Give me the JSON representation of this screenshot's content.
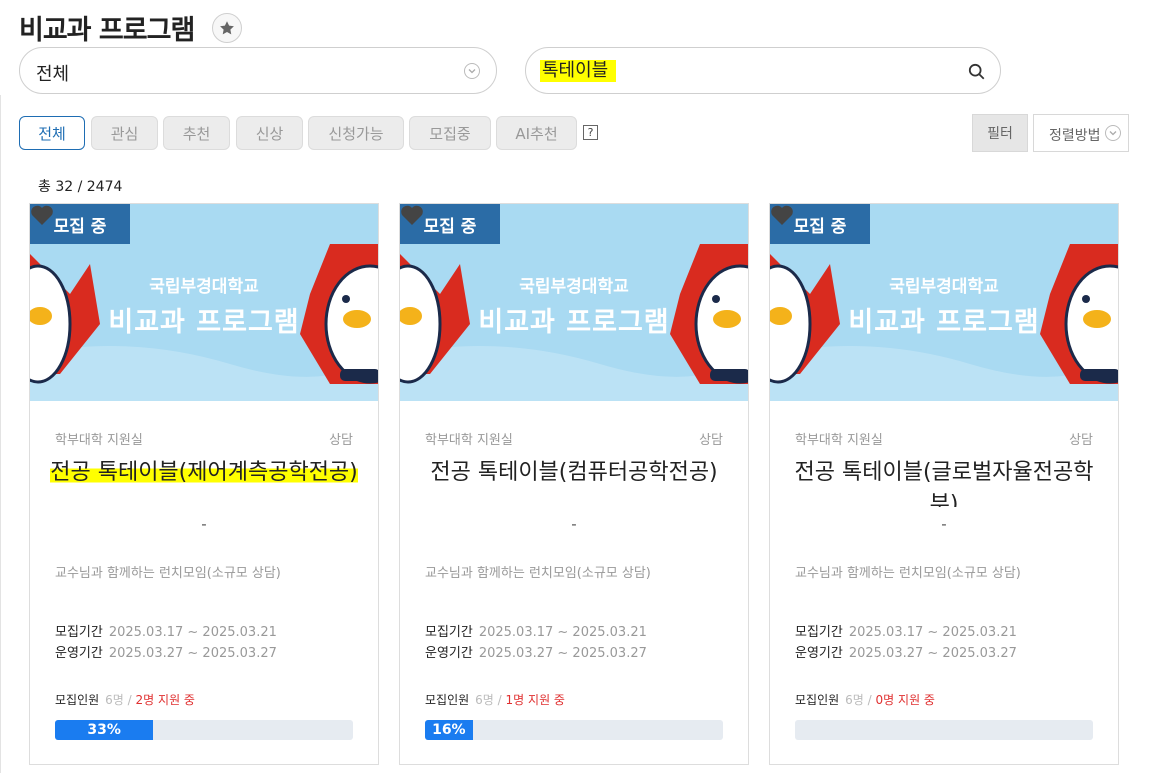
{
  "page": {
    "title": "비교과 프로그램"
  },
  "search": {
    "category_value": "전체",
    "query": "톡테이블"
  },
  "tabs": [
    "전체",
    "관심",
    "추천",
    "신상",
    "신청가능",
    "모집중",
    "AI추천"
  ],
  "help_label": "?",
  "toolbar": {
    "filter_label": "필터",
    "sort_label": "정렬방법"
  },
  "count_text": "총 32 / 2474",
  "colors": {
    "accent": "#1e6db3",
    "badge": "#2b6ca6",
    "progress": "#1a7cf0",
    "highlight": "#ffff00",
    "applied": "#e03030"
  },
  "cards": [
    {
      "badge": "모집 중",
      "banner_brand": "국립부경대학교",
      "banner_title": "비교과 프로그램",
      "dept": "학부대학 지원실",
      "category": "상담",
      "title": "전공 톡테이블(제어계측공학전공)",
      "dash": "-",
      "desc": "교수님과 함께하는 런치모임(소규모 상담)",
      "recruit_period_label": "모집기간",
      "recruit_period": "2025.03.17 ~ 2025.03.21",
      "run_period_label": "운영기간",
      "run_period": "2025.03.27 ~ 2025.03.27",
      "capacity_label": "모집인원",
      "capacity": "6명 /",
      "applied": "2명 지원 중",
      "progress_text": "33%",
      "progress": 0.33
    },
    {
      "badge": "모집 중",
      "banner_brand": "국립부경대학교",
      "banner_title": "비교과 프로그램",
      "dept": "학부대학 지원실",
      "category": "상담",
      "title": "전공 톡테이블(컴퓨터공학전공)",
      "dash": "-",
      "desc": "교수님과 함께하는 런치모임(소규모 상담)",
      "recruit_period_label": "모집기간",
      "recruit_period": "2025.03.17 ~ 2025.03.21",
      "run_period_label": "운영기간",
      "run_period": "2025.03.27 ~ 2025.03.27",
      "capacity_label": "모집인원",
      "capacity": "6명 /",
      "applied": "1명 지원 중",
      "progress_text": "16%",
      "progress": 0.16
    },
    {
      "badge": "모집 중",
      "banner_brand": "국립부경대학교",
      "banner_title": "비교과 프로그램",
      "dept": "학부대학 지원실",
      "category": "상담",
      "title": "전공 톡테이블(글로벌자율전공학부)",
      "dash": "-",
      "desc": "교수님과 함께하는 런치모임(소규모 상담)",
      "recruit_period_label": "모집기간",
      "recruit_period": "2025.03.17 ~ 2025.03.21",
      "run_period_label": "운영기간",
      "run_period": "2025.03.27 ~ 2025.03.27",
      "capacity_label": "모집인원",
      "capacity": "6명 /",
      "applied": "0명 지원 중",
      "progress_text": "",
      "progress": 0
    }
  ]
}
